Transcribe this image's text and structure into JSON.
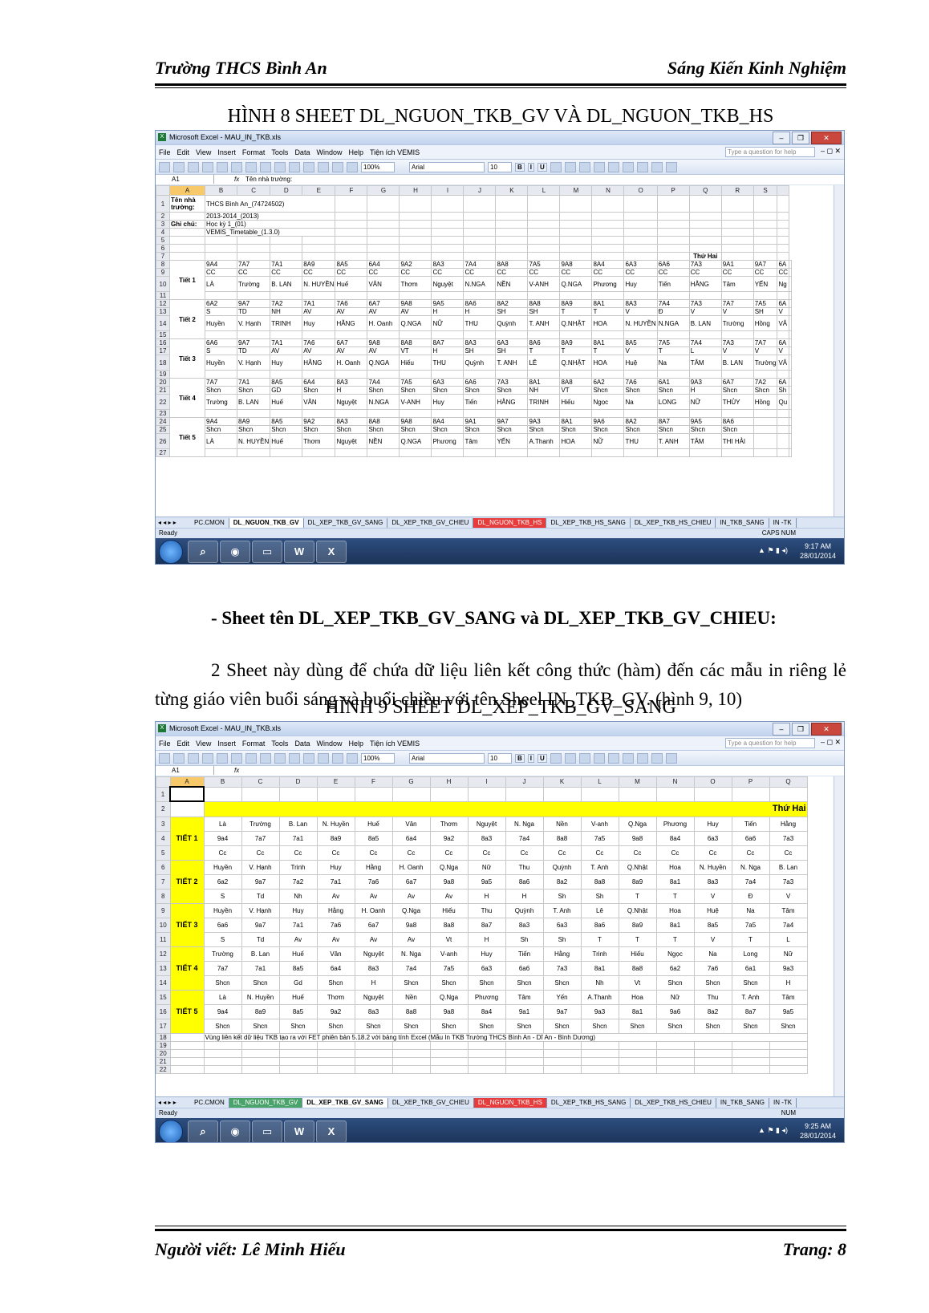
{
  "header": {
    "left": "Trường THCS Bình An",
    "right": "Sáng Kiến Kinh Nghiệm"
  },
  "fig8_title": "HÌNH 8 SHEET DL_NGUON_TKB_GV VÀ DL_NGUON_TKB_HS",
  "section_title": "- Sheet tên DL_XEP_TKB_GV_SANG và DL_XEP_TKB_GV_CHIEU:",
  "paragraph": "2 Sheet này dùng để chứa dữ liệu liên kết công thức (hàm) đến các mẫu in riêng lẻ từng giáo viên buổi sáng và buổi chiều với tên Sheel IN_TKB_GV. (hình 9, 10)",
  "fig9_title": "HÌNH 9 SHEET DL_XEP_TKB_GV_SANG",
  "footer": {
    "left": "Người viết: Lê Minh Hiếu",
    "right": "Trang: 8"
  },
  "excel": {
    "window_title": "Microsoft Excel - MAU_IN_TKB.xls",
    "menu": [
      "File",
      "Edit",
      "View",
      "Insert",
      "Format",
      "Tools",
      "Data",
      "Window",
      "Help",
      "Tiện ích VEMIS"
    ],
    "help_placeholder": "Type a question for help",
    "zoom": "100%",
    "font": "Arial",
    "font_size": "10",
    "name_box": "A1",
    "fx": "fx",
    "status": "Ready",
    "taskbar_icons": [
      "Q",
      "W",
      "X"
    ]
  },
  "shot1": {
    "formula_value": "Tên nhà trường:",
    "columns": [
      "A",
      "B",
      "C",
      "D",
      "E",
      "F",
      "G",
      "H",
      "I",
      "J",
      "K",
      "L",
      "M",
      "N",
      "O",
      "P",
      "Q",
      "R",
      "S"
    ],
    "info": {
      "r1a": "Tên nhà trường:",
      "r1b": "THCS Bình An_(74724502)",
      "r2b": "2013-2014_(2013)",
      "r3a": "Ghi chú:",
      "r3b": "Học kỳ 1_(01)",
      "r4b": "VEMIS_Timetable_(1.3.0)"
    },
    "thu": "Thứ Hai",
    "tiet": [
      {
        "label": "Tiết 1",
        "rows": [
          [
            "9A4",
            "7A7",
            "7A1",
            "8A9",
            "8A5",
            "6A4",
            "9A2",
            "8A3",
            "7A4",
            "8A8",
            "7A5",
            "9A8",
            "8A4",
            "6A3",
            "6A6",
            "7A3",
            "9A1",
            "9A7",
            "6A"
          ],
          [
            "CC",
            "CC",
            "CC",
            "CC",
            "CC",
            "CC",
            "CC",
            "CC",
            "CC",
            "CC",
            "CC",
            "CC",
            "CC",
            "CC",
            "CC",
            "CC",
            "CC",
            "CC",
            "CC"
          ],
          [
            "LÀ",
            "Trường",
            "B. LAN",
            "N. HUYỀN",
            "Huế",
            "VÂN",
            "Thơm",
            "Nguyệt",
            "N.NGA",
            "NỀN",
            "V-ANH",
            "Q.NGA",
            "Phương",
            "Huy",
            "Tiến",
            "HẰNG",
            "Tâm",
            "YẾN",
            "Ng"
          ]
        ]
      },
      {
        "label": "Tiết 2",
        "rows": [
          [
            "6A2",
            "9A7",
            "7A2",
            "7A1",
            "7A6",
            "6A7",
            "9A8",
            "9A5",
            "8A6",
            "8A2",
            "8A8",
            "8A9",
            "8A1",
            "8A3",
            "7A4",
            "7A3",
            "7A7",
            "7A5",
            "6A"
          ],
          [
            "S",
            "TD",
            "NH",
            "AV",
            "AV",
            "AV",
            "AV",
            "H",
            "H",
            "SH",
            "SH",
            "T",
            "T",
            "V",
            "Đ",
            "V",
            "V",
            "SH",
            "V"
          ],
          [
            "Huyền",
            "V. Hạnh",
            "TRINH",
            "Huy",
            "HẰNG",
            "H. Oanh",
            "Q.NGA",
            "NỮ",
            "THU",
            "Quỳnh",
            "T. ANH",
            "Q.NHẬT",
            "HOA",
            "N. HUYỀN",
            "N.NGA",
            "B. LAN",
            "Trường",
            "Hồng",
            "VÂ"
          ]
        ]
      },
      {
        "label": "Tiết 3",
        "rows": [
          [
            "6A6",
            "9A7",
            "7A1",
            "7A6",
            "6A7",
            "9A8",
            "8A8",
            "8A7",
            "8A3",
            "6A3",
            "8A6",
            "8A9",
            "8A1",
            "8A5",
            "7A5",
            "7A4",
            "7A3",
            "7A7",
            "6A"
          ],
          [
            "S",
            "TD",
            "AV",
            "AV",
            "AV",
            "AV",
            "VT",
            "H",
            "SH",
            "SH",
            "T",
            "T",
            "T",
            "V",
            "T",
            "L",
            "V",
            "V",
            "V"
          ],
          [
            "Huyền",
            "V. Hạnh",
            "Huy",
            "HẰNG",
            "H. Oanh",
            "Q.NGA",
            "Hiếu",
            "THU",
            "Quỳnh",
            "T. ANH",
            "LÊ",
            "Q.NHẬT",
            "HOA",
            "Huệ",
            "Na",
            "TÂM",
            "B. LAN",
            "Trường",
            "VÂ"
          ]
        ]
      },
      {
        "label": "Tiết 4",
        "rows": [
          [
            "7A7",
            "7A1",
            "8A5",
            "6A4",
            "8A3",
            "7A4",
            "7A5",
            "6A3",
            "6A6",
            "7A3",
            "8A1",
            "8A8",
            "6A2",
            "7A6",
            "6A1",
            "9A3",
            "6A7",
            "7A2",
            "6A"
          ],
          [
            "Shcn",
            "Shcn",
            "GD",
            "Shcn",
            "H",
            "Shcn",
            "Shcn",
            "Shcn",
            "Shcn",
            "Shcn",
            "NH",
            "VT",
            "Shcn",
            "Shcn",
            "Shcn",
            "H",
            "Shcn",
            "Shcn",
            "Sh"
          ],
          [
            "Trường",
            "B. LAN",
            "Huế",
            "VÂN",
            "Nguyệt",
            "N.NGA",
            "V-ANH",
            "Huy",
            "Tiến",
            "HẰNG",
            "TRINH",
            "Hiếu",
            "Ngọc",
            "Na",
            "LONG",
            "NỮ",
            "THỦY",
            "Hồng",
            "Qu"
          ]
        ]
      },
      {
        "label": "Tiết 5",
        "rows": [
          [
            "9A4",
            "8A9",
            "8A5",
            "9A2",
            "8A3",
            "8A8",
            "9A8",
            "8A4",
            "9A1",
            "9A7",
            "9A3",
            "8A1",
            "9A6",
            "8A2",
            "8A7",
            "9A5",
            "8A6",
            "",
            ""
          ],
          [
            "Shcn",
            "Shcn",
            "Shcn",
            "Shcn",
            "Shcn",
            "Shcn",
            "Shcn",
            "Shcn",
            "Shcn",
            "Shcn",
            "Shcn",
            "Shcn",
            "Shcn",
            "Shcn",
            "Shcn",
            "Shcn",
            "Shcn",
            "",
            ""
          ],
          [
            "LÀ",
            "N. HUYỀN",
            "Huế",
            "Thơm",
            "Nguyệt",
            "NỀN",
            "Q.NGA",
            "Phương",
            "Tâm",
            "YẾN",
            "A.Thanh",
            "HOA",
            "NỮ",
            "THU",
            "T. ANH",
            "TÂM",
            "THI HẢI",
            "",
            ""
          ]
        ]
      }
    ],
    "tabs": [
      "PC.CMON",
      "DL_NGUON_TKB_GV",
      "DL_XEP_TKB_GV_SANG",
      "DL_XEP_TKB_GV_CHIEU",
      "DL_NGUON_TKB_HS",
      "DL_XEP_TKB_HS_SANG",
      "DL_XEP_TKB_HS_CHIEU",
      "IN_TKB_SANG",
      "IN -TK"
    ],
    "caps": "CAPS NUM",
    "clock_time": "9:17 AM",
    "clock_date": "28/01/2014"
  },
  "shot2": {
    "formula_value": "",
    "columns": [
      "A",
      "B",
      "C",
      "D",
      "E",
      "F",
      "G",
      "H",
      "I",
      "J",
      "K",
      "L",
      "M",
      "N",
      "O",
      "P",
      "Q"
    ],
    "thu": "Thứ Hai",
    "tiet": [
      {
        "label": "TIẾT 1",
        "rows": [
          [
            "Là",
            "Trường",
            "B. Lan",
            "N. Huyền",
            "Huế",
            "Vân",
            "Thơm",
            "Nguyệt",
            "N. Nga",
            "Nền",
            "V-anh",
            "Q.Nga",
            "Phương",
            "Huy",
            "Tiến",
            "Hằng"
          ],
          [
            "9a4",
            "7a7",
            "7a1",
            "8a9",
            "8a5",
            "6a4",
            "9a2",
            "8a3",
            "7a4",
            "8a8",
            "7a5",
            "9a8",
            "8a4",
            "6a3",
            "6a6",
            "7a3"
          ],
          [
            "Cc",
            "Cc",
            "Cc",
            "Cc",
            "Cc",
            "Cc",
            "Cc",
            "Cc",
            "Cc",
            "Cc",
            "Cc",
            "Cc",
            "Cc",
            "Cc",
            "Cc",
            "Cc"
          ]
        ]
      },
      {
        "label": "TIẾT 2",
        "rows": [
          [
            "Huyền",
            "V. Hạnh",
            "Trinh",
            "Huy",
            "Hằng",
            "H. Oanh",
            "Q.Nga",
            "Nữ",
            "Thu",
            "Quỳnh",
            "T. Anh",
            "Q.Nhật",
            "Hoa",
            "N. Huyền",
            "N. Nga",
            "B. Lan"
          ],
          [
            "6a2",
            "9a7",
            "7a2",
            "7a1",
            "7a6",
            "6a7",
            "9a8",
            "9a5",
            "8a6",
            "8a2",
            "8a8",
            "8a9",
            "8a1",
            "8a3",
            "7a4",
            "7a3"
          ],
          [
            "S",
            "Td",
            "Nh",
            "Av",
            "Av",
            "Av",
            "Av",
            "H",
            "H",
            "Sh",
            "Sh",
            "T",
            "T",
            "V",
            "Đ",
            "V"
          ]
        ]
      },
      {
        "label": "TIẾT 3",
        "rows": [
          [
            "Huyền",
            "V. Hạnh",
            "Huy",
            "Hằng",
            "H. Oanh",
            "Q.Nga",
            "Hiếu",
            "Thu",
            "Quỳnh",
            "T. Anh",
            "Lê",
            "Q.Nhật",
            "Hoa",
            "Huệ",
            "Na",
            "Tâm"
          ],
          [
            "6a6",
            "9a7",
            "7a1",
            "7a6",
            "6a7",
            "9a8",
            "8a8",
            "8a7",
            "8a3",
            "6a3",
            "8a6",
            "8a9",
            "8a1",
            "8a5",
            "7a5",
            "7a4"
          ],
          [
            "S",
            "Td",
            "Av",
            "Av",
            "Av",
            "Av",
            "Vt",
            "H",
            "Sh",
            "Sh",
            "T",
            "T",
            "T",
            "V",
            "T",
            "L"
          ]
        ]
      },
      {
        "label": "TIẾT 4",
        "rows": [
          [
            "Trường",
            "B. Lan",
            "Huế",
            "Vân",
            "Nguyệt",
            "N. Nga",
            "V-anh",
            "Huy",
            "Tiến",
            "Hằng",
            "Trinh",
            "Hiếu",
            "Ngọc",
            "Na",
            "Long",
            "Nữ"
          ],
          [
            "7a7",
            "7a1",
            "8a5",
            "6a4",
            "8a3",
            "7a4",
            "7a5",
            "6a3",
            "6a6",
            "7a3",
            "8a1",
            "8a8",
            "6a2",
            "7a6",
            "6a1",
            "9a3"
          ],
          [
            "Shcn",
            "Shcn",
            "Gd",
            "Shcn",
            "H",
            "Shcn",
            "Shcn",
            "Shcn",
            "Shcn",
            "Shcn",
            "Nh",
            "Vt",
            "Shcn",
            "Shcn",
            "Shcn",
            "H"
          ]
        ]
      },
      {
        "label": "TIẾT 5",
        "rows": [
          [
            "Là",
            "N. Huyền",
            "Huế",
            "Thơm",
            "Nguyệt",
            "Nền",
            "Q.Nga",
            "Phương",
            "Tâm",
            "Yến",
            "A.Thanh",
            "Hoa",
            "Nữ",
            "Thu",
            "T. Anh",
            "Tâm"
          ],
          [
            "9a4",
            "8a9",
            "8a5",
            "9a2",
            "8a3",
            "8a8",
            "9a8",
            "8a4",
            "9a1",
            "9a7",
            "9a3",
            "8a1",
            "9a6",
            "8a2",
            "8a7",
            "9a5"
          ],
          [
            "Shcn",
            "Shcn",
            "Shcn",
            "Shcn",
            "Shcn",
            "Shcn",
            "Shcn",
            "Shcn",
            "Shcn",
            "Shcn",
            "Shcn",
            "Shcn",
            "Shcn",
            "Shcn",
            "Shcn",
            "Shcn"
          ]
        ]
      }
    ],
    "note": "Vùng liên kết dữ liệu TKB tạo ra với FET phiên bản 5.18.2 với bảng tính Excel (Mẫu In TKB Trường THCS Bình An - Dĩ An - Bình Dương)",
    "tabs": [
      "PC.CMON",
      "DL_NGUON_TKB_GV",
      "DL_XEP_TKB_GV_SANG",
      "DL_XEP_TKB_GV_CHIEU",
      "DL_NGUON_TKB_HS",
      "DL_XEP_TKB_HS_SANG",
      "DL_XEP_TKB_HS_CHIEU",
      "IN_TKB_SANG",
      "IN -TK"
    ],
    "caps": "NUM",
    "clock_time": "9:25 AM",
    "clock_date": "28/01/2014"
  }
}
